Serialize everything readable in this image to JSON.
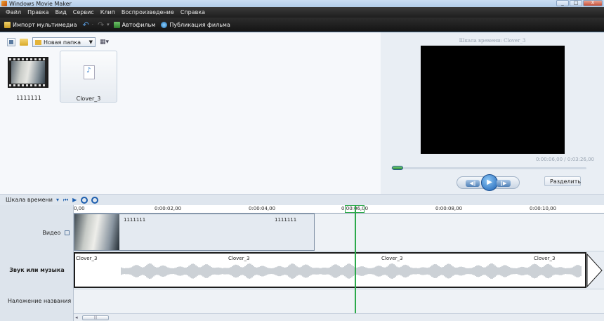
{
  "window": {
    "title": "Windows Movie Maker",
    "controls": [
      "_",
      "□",
      "X"
    ]
  },
  "menu": [
    "Файл",
    "Правка",
    "Вид",
    "Сервис",
    "Клип",
    "Воспроизведение",
    "Справка"
  ],
  "toolbar": {
    "import_label": "Импорт мультимедиа",
    "automovie_label": "Автофильм",
    "publish_label": "Публикация фильма"
  },
  "collection": {
    "folder_name": "Новая папка",
    "items": [
      {
        "name": "1111111",
        "type": "video",
        "icon": "video-thumbnail"
      },
      {
        "name": "Clover_3",
        "type": "audio",
        "icon": "audio-file-icon"
      }
    ]
  },
  "preview": {
    "title": "Шкала времени: Clover_3",
    "time": "0:00:06,00 / 0:03:26,00",
    "split_label": "Разделить",
    "seek_fraction": 0.03
  },
  "timeline": {
    "label": "Шкала времени",
    "ruler": [
      {
        "label": "0,00",
        "pos": 0
      },
      {
        "label": "0:00:02,00",
        "pos": 2
      },
      {
        "label": "0:00:04,00",
        "pos": 4
      },
      {
        "label": "0:00:06,00",
        "pos": 6
      },
      {
        "label": "0:00:08,00",
        "pos": 8
      },
      {
        "label": "0:00:10,00",
        "pos": 10
      }
    ],
    "tracks": {
      "video": "Видео",
      "audio": "Звук или музыка",
      "title_overlay": "Наложение названия"
    },
    "video_clip_labels": [
      "1111111",
      "1111111"
    ],
    "audio_clip_labels": [
      "Clover_3",
      "Clover_3",
      "Clover_3",
      "Clover_3"
    ],
    "playhead_time": 6.1
  },
  "colors": {
    "playhead": "#2ba94a",
    "accent": "#1e5fae",
    "menubar": "#1e1e1e"
  }
}
